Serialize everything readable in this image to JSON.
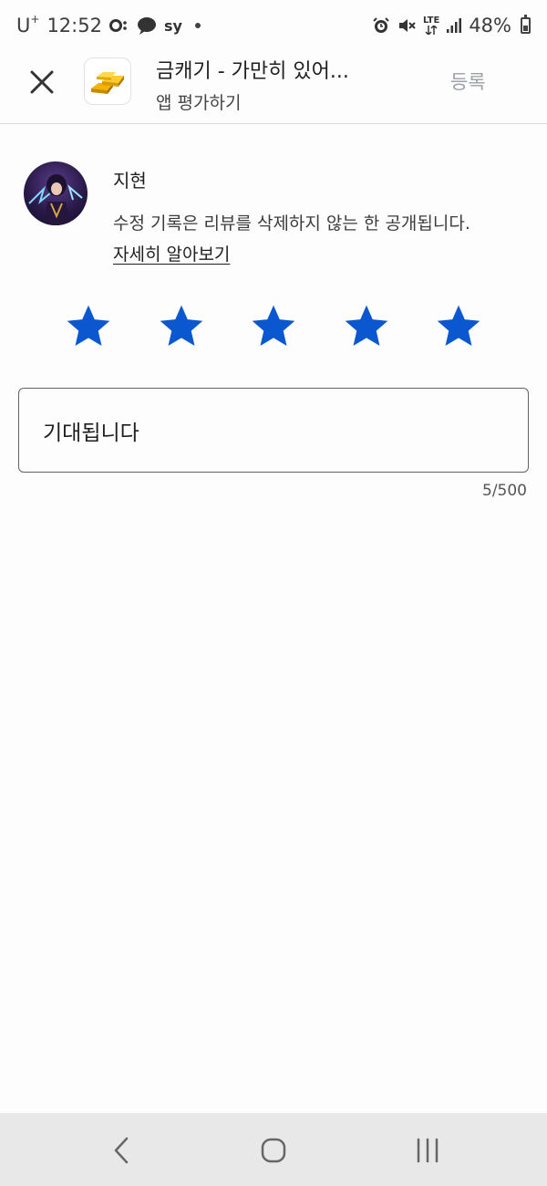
{
  "status_bar": {
    "carrier": "U",
    "carrier_sup": "+",
    "time": "12:52",
    "notif_icons": [
      "o-icon",
      "chat-icon",
      "sy"
    ],
    "sy_text": "sy",
    "lte_text": "LTE",
    "battery": "48%"
  },
  "app_bar": {
    "title": "금캐기 - 가만히 있어...",
    "subtitle": "앱 평가하기",
    "submit_label": "등록",
    "close_icon": "close-icon",
    "app_icon": "gold-bars-icon"
  },
  "user": {
    "name": "지현",
    "notice_text": "수정 기록은 리뷰를 삭제하지 않는 한 공개됩니다.",
    "learn_more": "자세히 알아보기"
  },
  "rating": {
    "stars": 5,
    "max": 5,
    "star_color": "#0b57d0"
  },
  "review": {
    "text": "기대됩니다",
    "char_count": "5/500"
  },
  "nav_bar": {
    "back_icon": "back-icon",
    "home_icon": "home-icon",
    "recents_icon": "recents-icon"
  }
}
